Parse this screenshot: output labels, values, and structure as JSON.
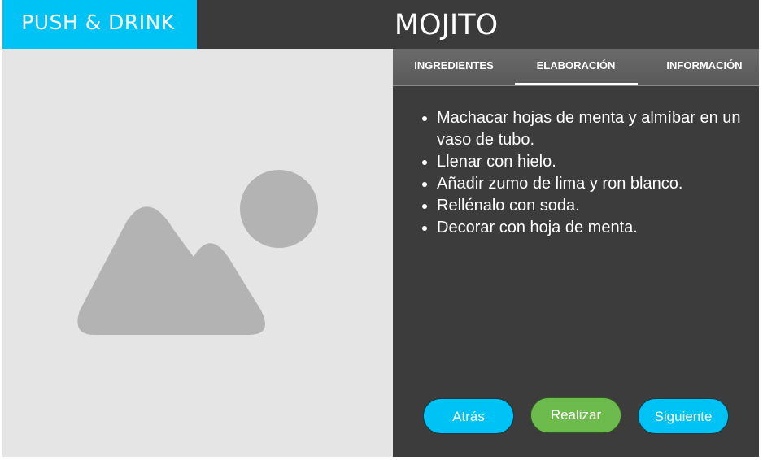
{
  "header": {
    "brand": "PUSH & DRINK",
    "title": "MOJITO"
  },
  "image": {
    "icon": "image-placeholder-icon"
  },
  "tabs": [
    {
      "label": "INGREDIENTES",
      "active": false
    },
    {
      "label": "ELABORACIÓN",
      "active": true
    },
    {
      "label": "INFORMACIÓN",
      "active": false
    }
  ],
  "steps": [
    "Machacar hojas de menta y almíbar en un vaso de tubo.",
    "Llenar con hielo.",
    "Añadir zumo de lima y ron blanco.",
    "Rellénalo con soda.",
    "Decorar con hoja de menta."
  ],
  "buttons": {
    "back": "Atrás",
    "make": "Realizar",
    "next": "Siguiente"
  },
  "colors": {
    "accent": "#00c3f5",
    "confirm": "#6dba4d",
    "header_bg": "#3b3b3b",
    "panel_bg": "#3c3c3c",
    "image_bg": "#e5e5e5",
    "placeholder": "#b3b3b3"
  }
}
